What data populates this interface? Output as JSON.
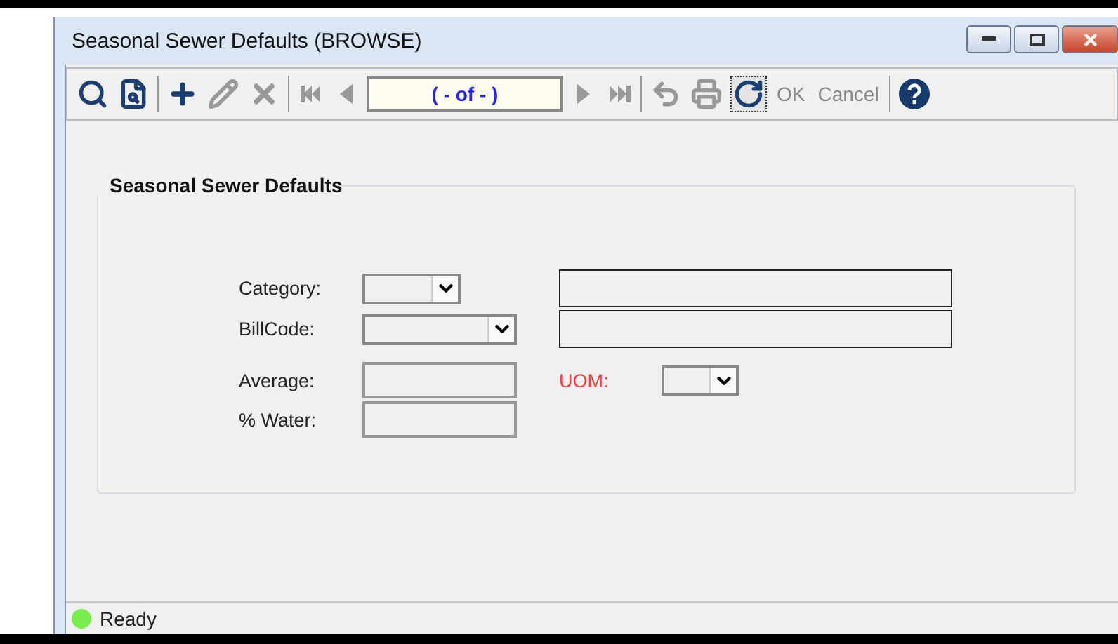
{
  "window": {
    "title": "Seasonal Sewer Defaults (BROWSE)"
  },
  "toolbar": [
    {
      "kind": "search",
      "disabled": false
    },
    {
      "kind": "browse",
      "disabled": false
    },
    {
      "kind": "separator"
    },
    {
      "kind": "add",
      "disabled": false
    },
    {
      "kind": "edit",
      "disabled": true
    },
    {
      "kind": "delete",
      "disabled": true
    },
    {
      "kind": "separator"
    },
    {
      "kind": "first",
      "disabled": true
    },
    {
      "kind": "prev",
      "disabled": true
    },
    {
      "kind": "record",
      "text": "( - of - )"
    },
    {
      "kind": "next",
      "disabled": true
    },
    {
      "kind": "last",
      "disabled": true
    },
    {
      "kind": "separator"
    },
    {
      "kind": "undo",
      "disabled": true
    },
    {
      "kind": "print",
      "disabled": true
    },
    {
      "kind": "refresh",
      "disabled": false
    },
    {
      "kind": "text",
      "label": "OK",
      "disabled": true
    },
    {
      "kind": "text",
      "label": "Cancel",
      "disabled": true
    },
    {
      "kind": "separator"
    },
    {
      "kind": "help",
      "disabled": false
    }
  ],
  "group": {
    "title": "Seasonal Sewer Defaults",
    "rows": [
      {
        "label": "Category:",
        "kind": "short_combo"
      },
      {
        "label": "BillCode:",
        "kind": "long_combo"
      },
      {
        "label": "Average:",
        "kind": "field",
        "uom": {
          "label": "UOM:"
        }
      },
      {
        "label": "% Water:",
        "kind": "field"
      }
    ]
  },
  "status_bar": {
    "text": "Ready",
    "color": "#77ee4d"
  }
}
